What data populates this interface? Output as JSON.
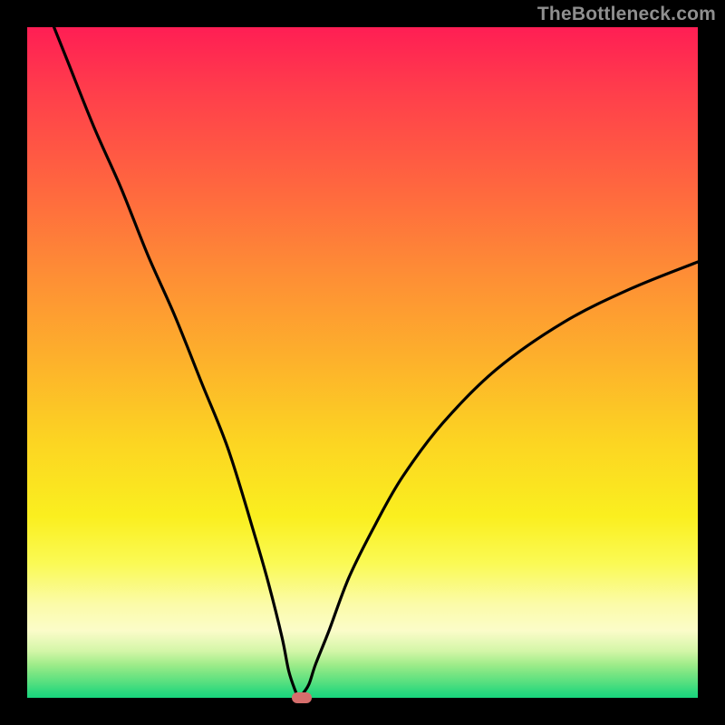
{
  "watermark": "TheBottleneck.com",
  "colors": {
    "frame": "#000000",
    "curve": "#000000",
    "marker": "#D66E6C",
    "watermark": "#8F8F8F"
  },
  "chart_data": {
    "type": "line",
    "title": "",
    "xlabel": "",
    "ylabel": "",
    "xlim": [
      0,
      100
    ],
    "ylim": [
      0,
      100
    ],
    "grid": false,
    "legend": false,
    "series": [
      {
        "name": "bottleneck-curve",
        "x": [
          4,
          6,
          10,
          14,
          18,
          22,
          26,
          30,
          34,
          36,
          38,
          39,
          40,
          40.5,
          41,
          42,
          43,
          45,
          48,
          52,
          56,
          62,
          70,
          80,
          90,
          100
        ],
        "values": [
          100,
          95,
          85,
          76,
          66,
          57,
          47,
          37,
          24,
          17,
          9,
          4,
          1,
          0,
          0.5,
          2,
          5,
          10,
          18,
          26,
          33,
          41,
          49,
          56,
          61,
          65
        ]
      }
    ],
    "marker": {
      "x": 41,
      "y": 0
    },
    "background_gradient_stops": [
      {
        "pos": 0.0,
        "color": "#FF1E54"
      },
      {
        "pos": 0.5,
        "color": "#FDB22B"
      },
      {
        "pos": 0.8,
        "color": "#FAFA55"
      },
      {
        "pos": 1.0,
        "color": "#18D57D"
      }
    ]
  }
}
